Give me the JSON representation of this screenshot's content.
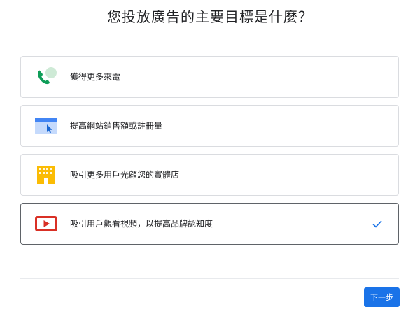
{
  "header": {
    "title": "您投放廣告的主要目標是什麼？"
  },
  "options": [
    {
      "label": "獲得更多來電",
      "icon": "phone-call-icon",
      "selected": false
    },
    {
      "label": "提高網站銷售額或註冊量",
      "icon": "website-click-icon",
      "selected": false
    },
    {
      "label": "吸引更多用戶光顧您的實體店",
      "icon": "storefront-icon",
      "selected": false
    },
    {
      "label": "吸引用戶觀看視頻，以提高品牌認知度",
      "icon": "video-play-icon",
      "selected": true
    }
  ],
  "footer": {
    "next_label": "下一步"
  },
  "colors": {
    "accent": "#1a73e8",
    "phone_green": "#0f9d58",
    "phone_bubble": "#ceead6",
    "website_blue": "#4285f4",
    "store_yellow": "#fbbc04",
    "video_red": "#d93025",
    "border": "#dadce0"
  }
}
